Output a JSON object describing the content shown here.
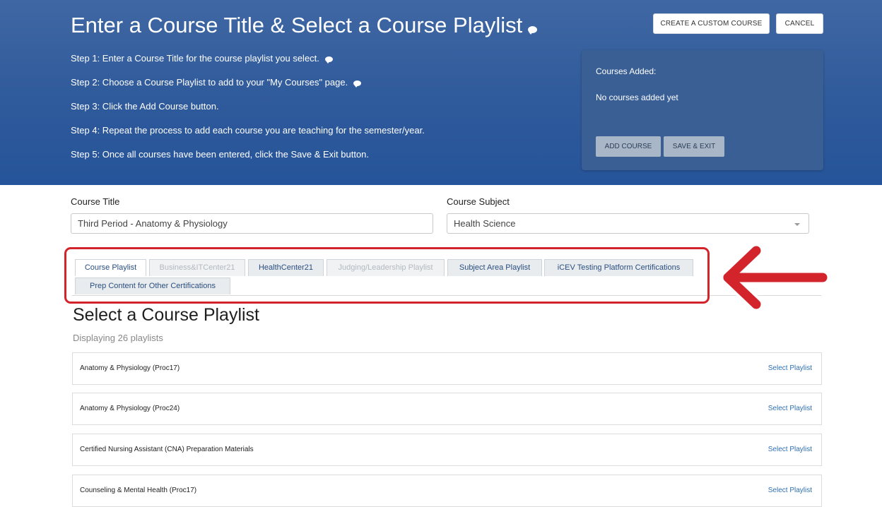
{
  "header": {
    "title": "Enter a Course Title & Select a Course Playlist",
    "steps": [
      "Step 1: Enter a Course Title for the course playlist you select.",
      "Step 2: Choose a Course Playlist to add to your \"My Courses\" page.",
      "Step 3: Click the Add Course button.",
      "Step 4: Repeat the process to add each course you are teaching for the semester/year.",
      "Step 5: Once all courses have been entered, click the Save & Exit button."
    ],
    "create_custom_label": "CREATE A CUSTOM COURSE",
    "cancel_label": "CANCEL"
  },
  "courses_panel": {
    "heading": "Courses Added:",
    "empty_text": "No courses added yet",
    "add_course_label": "ADD COURSE",
    "save_exit_label": "SAVE & EXIT"
  },
  "form": {
    "course_title_label": "Course Title",
    "course_title_value": "Third Period - Anatomy & Physiology",
    "course_subject_label": "Course Subject",
    "course_subject_value": "Health Science"
  },
  "tabs": [
    {
      "label": "Course Playlist",
      "state": "active"
    },
    {
      "label": "Business&ITCenter21",
      "state": "disabled"
    },
    {
      "label": "HealthCenter21",
      "state": "normal"
    },
    {
      "label": "Judging/Leadership Playlist",
      "state": "disabled"
    },
    {
      "label": "Subject Area Playlist",
      "state": "normal"
    },
    {
      "label": "iCEV Testing Platform Certifications",
      "state": "normal"
    },
    {
      "label": "Prep Content for Other Certifications",
      "state": "normal"
    }
  ],
  "playlists": {
    "heading": "Select a Course Playlist",
    "count_text": "Displaying 26 playlists",
    "select_label": "Select Playlist",
    "items": [
      "Anatomy & Physiology (Proc17)",
      "Anatomy & Physiology (Proc24)",
      "Certified Nursing Assistant (CNA) Preparation Materials",
      "Counseling & Mental Health (Proc17)"
    ]
  },
  "colors": {
    "banner": "#2f5a9b",
    "panel": "#3a5f95",
    "annotation_red": "#d3242c",
    "link": "#2f6fb0"
  }
}
